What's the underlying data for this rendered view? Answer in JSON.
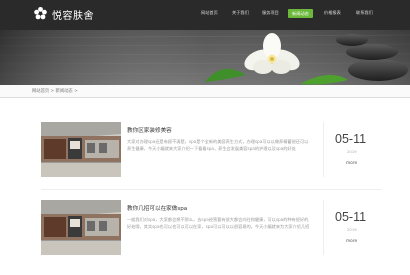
{
  "site": {
    "name": "悦容肤舍"
  },
  "nav": [
    {
      "label": "网站首页"
    },
    {
      "label": "关于我们"
    },
    {
      "label": "服务项目"
    },
    {
      "label": "新闻动态",
      "active": true
    },
    {
      "label": "价格报表"
    },
    {
      "label": "联系我们"
    }
  ],
  "breadcrumb": "网站首页 > 新闻动态 >",
  "articles": [
    {
      "title": "教你区家装修美容",
      "desc": [
        "大家对办理spa还是有顾不清楚，spa是个全新的美容养生方式，办理spa可以以做养精蓄锐还可以以",
        "养生健康，今天小编就来大家介绍一下看看spa，养生会发展美容spa的护理以及spa的好处"
      ],
      "day": "05-11",
      "year": "2019",
      "more": "more"
    },
    {
      "title": "教你几招可以在家做spa",
      "desc": [
        "一般我们对spa，大家都会想不那么，去spa经营要有很大都会向往和健康，可以spa的种有很好的果和",
        "好处哦，其实spa也可以也可以可以在家，spa可以可以以很容易的。今天小编就来为大家介绍几招"
      ],
      "day": "05-11",
      "year": "2019",
      "more": "more"
    }
  ],
  "colors": {
    "accent": "#6bb83a",
    "topbar": "#2a2a2a"
  }
}
